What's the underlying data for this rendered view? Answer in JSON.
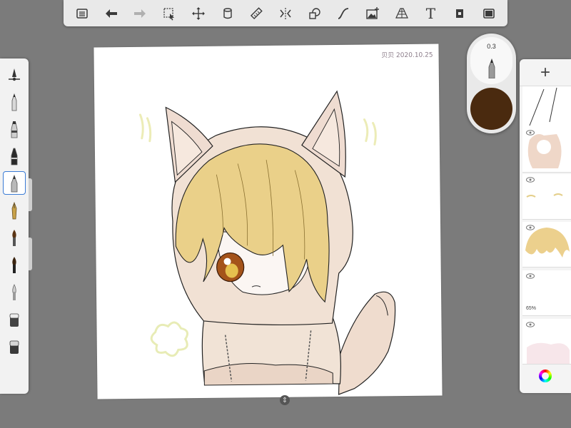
{
  "toolbar": {
    "buttons": [
      {
        "name": "gallery-list-icon",
        "enabled": true
      },
      {
        "name": "undo-icon",
        "enabled": true
      },
      {
        "name": "redo-icon",
        "enabled": false
      },
      {
        "name": "selection-icon",
        "enabled": true
      },
      {
        "name": "transform-icon",
        "enabled": true
      },
      {
        "name": "copy-layer-icon",
        "enabled": true
      },
      {
        "name": "ruler-icon",
        "enabled": true
      },
      {
        "name": "symmetry-icon",
        "enabled": true
      },
      {
        "name": "shapes-icon",
        "enabled": true
      },
      {
        "name": "curve-icon",
        "enabled": true
      },
      {
        "name": "import-image-icon",
        "enabled": true
      },
      {
        "name": "perspective-guide-icon",
        "enabled": true
      },
      {
        "name": "text-icon",
        "enabled": true
      },
      {
        "name": "flipbook-icon",
        "enabled": true
      },
      {
        "name": "fullscreen-icon",
        "enabled": true
      }
    ],
    "text_tool_glyph": "T"
  },
  "brushes": [
    {
      "name": "pencil",
      "selected": false
    },
    {
      "name": "marker",
      "selected": false
    },
    {
      "name": "ink-pen",
      "selected": false
    },
    {
      "name": "airbrush",
      "selected": true
    },
    {
      "name": "fountain-pen",
      "selected": false
    },
    {
      "name": "paintbrush",
      "selected": false
    },
    {
      "name": "soft-brush",
      "selected": false
    },
    {
      "name": "smudge",
      "selected": false
    },
    {
      "name": "eraser",
      "selected": false
    },
    {
      "name": "hard-eraser",
      "selected": false
    }
  ],
  "canvas": {
    "signature": "贝贝 2020.10.25"
  },
  "puck": {
    "brush_size": "0.3",
    "current_color": "#4a2a0f"
  },
  "layers": [
    {
      "id": "lines",
      "visible": true,
      "opacity": ""
    },
    {
      "id": "fill",
      "visible": true,
      "opacity": ""
    },
    {
      "id": "eyes",
      "visible": true,
      "opacity": ""
    },
    {
      "id": "hair",
      "visible": true,
      "opacity": ""
    },
    {
      "id": "shading",
      "visible": true,
      "opacity": "65%"
    },
    {
      "id": "background",
      "visible": true,
      "opacity": ""
    }
  ],
  "colors": {
    "accent": "#3a7bd5",
    "hair": "#e8cd7a",
    "hood": "#ecd6c8",
    "eye": "#b3641f"
  }
}
